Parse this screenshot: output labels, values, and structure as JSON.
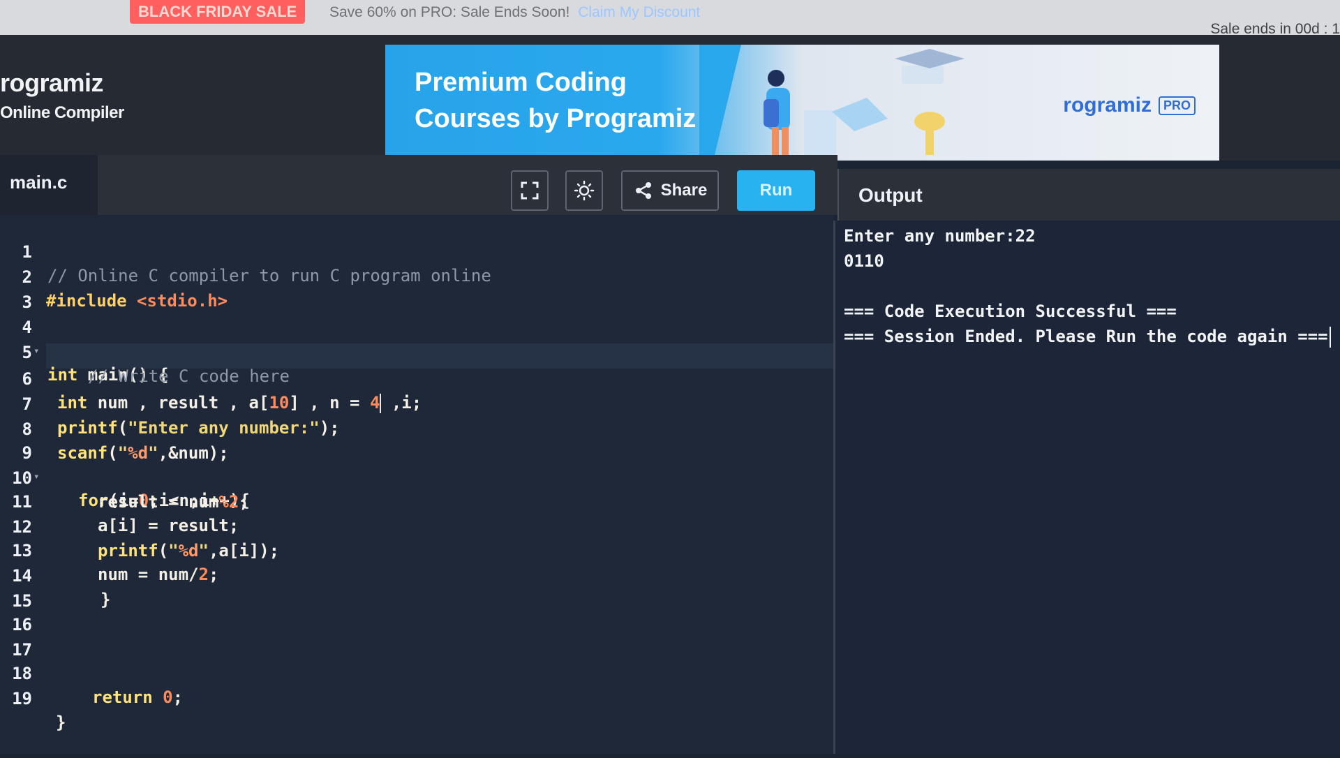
{
  "promo": {
    "badge": "BLACK FRIDAY SALE",
    "text": "Save 60% on PRO: Sale Ends Soon!",
    "link": "Claim My Discount",
    "timer": "Sale ends in 00d : 1"
  },
  "brand": {
    "name": "rogramiz",
    "subtitle": "Online Compiler"
  },
  "ad": {
    "title_line1": "Premium Coding",
    "title_line2": "Courses by Programiz",
    "logo": "rogramiz",
    "logo_badge": "PRO"
  },
  "toolbar": {
    "file_tab": "main.c",
    "share_label": "Share",
    "run_label": "Run",
    "fullscreen_icon": "fullscreen-icon",
    "theme_icon": "sun-icon",
    "share_icon": "share-icon"
  },
  "editor": {
    "line_numbers": [
      "1",
      "2",
      "3",
      "4",
      "5",
      "6",
      "7",
      "8",
      "9",
      "10",
      "11",
      "12",
      "13",
      "14",
      "15",
      "16",
      "17",
      "18",
      "19"
    ],
    "lines": [
      "// Online C compiler to run C program online",
      "#include <stdio.h>",
      "",
      "int main() {",
      "// Write C code here",
      "int num , result , a[10] , n = 4 ,i;",
      "printf(\"Enter any number:\");",
      "scanf(\"%d\",&num);",
      "for(i=0;i<n;i++){",
      "result = num%2;",
      "a[i] = result;",
      "printf(\"%d\",a[i]);",
      "num = num/2;",
      "}",
      "",
      "",
      "",
      "return 0;",
      "}"
    ]
  },
  "output": {
    "title": "Output",
    "lines": [
      "Enter any number:22",
      "0110",
      "",
      "=== Code Execution Successful ===",
      "=== Session Ended. Please Run the code again ==="
    ]
  },
  "colors": {
    "run_button": "#28b2f0",
    "editor_bg": "#1e2838",
    "header_bg": "#262a33",
    "promo_badge": "#ff5f5f"
  }
}
